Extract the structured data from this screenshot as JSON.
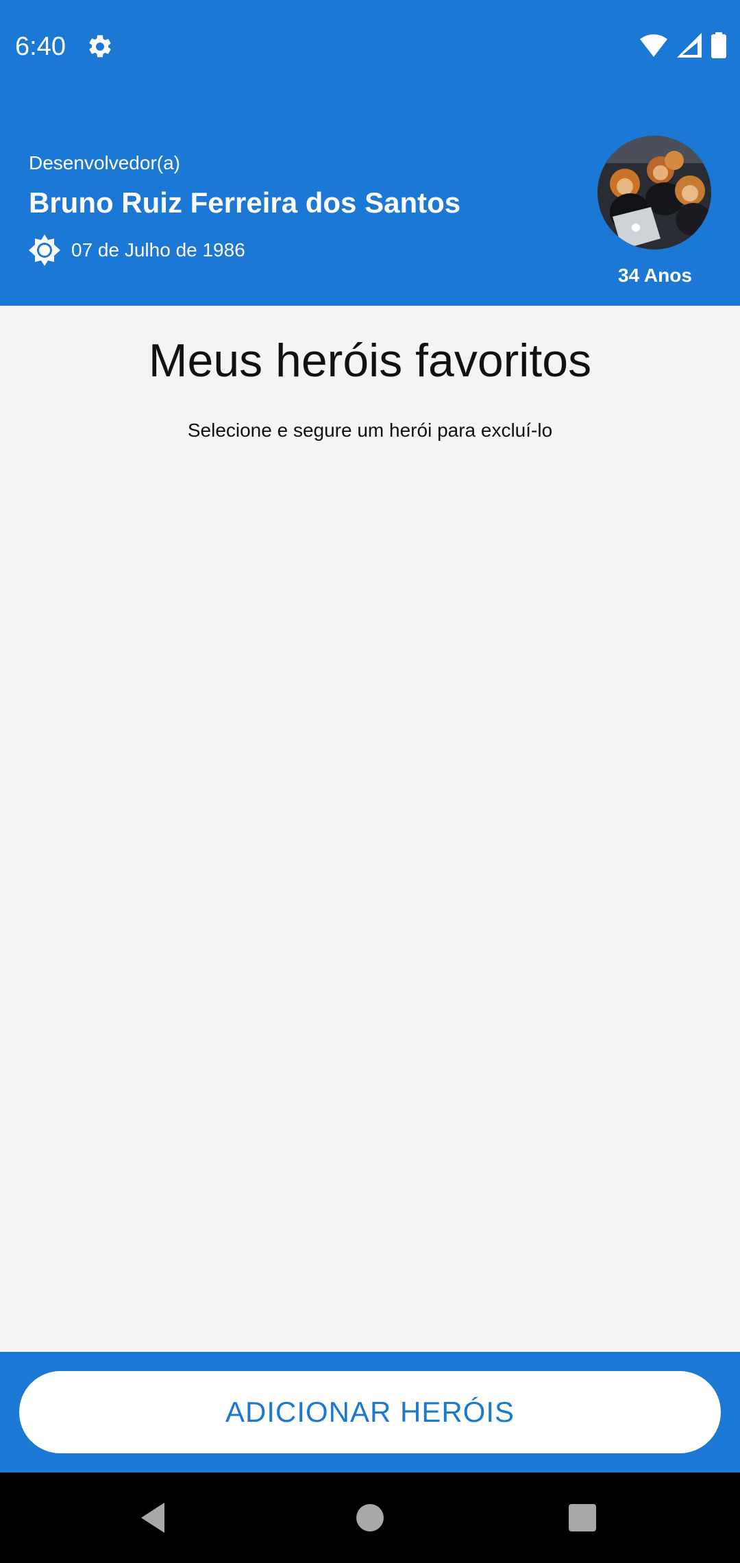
{
  "status_bar": {
    "time": "6:40",
    "icons": [
      "settings-icon",
      "wifi-icon",
      "signal-icon",
      "battery-icon"
    ]
  },
  "profile": {
    "role": "Desenvolvedor(a)",
    "name": "Bruno Ruiz Ferreira dos Santos",
    "birth_date": "07 de Julho de 1986",
    "birth_icon": "sun-icon",
    "age": "34 Anos",
    "avatar": "profile-photo"
  },
  "main": {
    "title": "Meus heróis favoritos",
    "subtitle": "Selecione e segure um herói para excluí-lo"
  },
  "actions": {
    "add_button_label": "ADICIONAR HERÓIS"
  },
  "nav_bar": {
    "icons": [
      "back-icon",
      "home-icon",
      "recents-icon"
    ]
  },
  "colors": {
    "primary": "#1b78d4",
    "background": "#f4f4f4",
    "button_bg": "#ffffff",
    "nav_bg": "#000000"
  }
}
